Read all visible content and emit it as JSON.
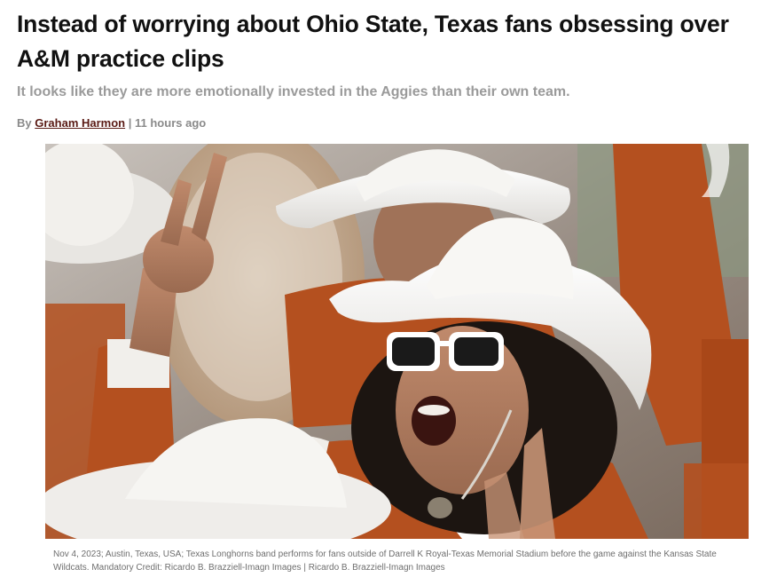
{
  "article": {
    "headline": "Instead of worrying about Ohio State, Texas fans obsessing over A&M practice clips",
    "subheadline": "It looks like they are more emotionally invested in the Aggies than their own team.",
    "byline": {
      "prefix": "By",
      "author": "Graham Harmon",
      "separator": "|",
      "timestamp": "11 hours ago"
    },
    "image": {
      "alt": "Texas Longhorns band member in white cowboy hat and sunglasses shouting with Hook 'em Horns hand sign"
    },
    "caption": "Nov 4, 2023; Austin, Texas, USA; Texas Longhorns band performs for fans outside of Darrell K Royal-Texas Memorial Stadium before the game against the Kansas State Wildcats. Mandatory Credit: Ricardo B. Brazziell-Imagn Images | Ricardo B. Brazziell-Imagn Images"
  },
  "colors": {
    "author_link": "#5a1a14",
    "burnt_orange": "#b4501f",
    "muted_text": "#9a9a9a"
  }
}
